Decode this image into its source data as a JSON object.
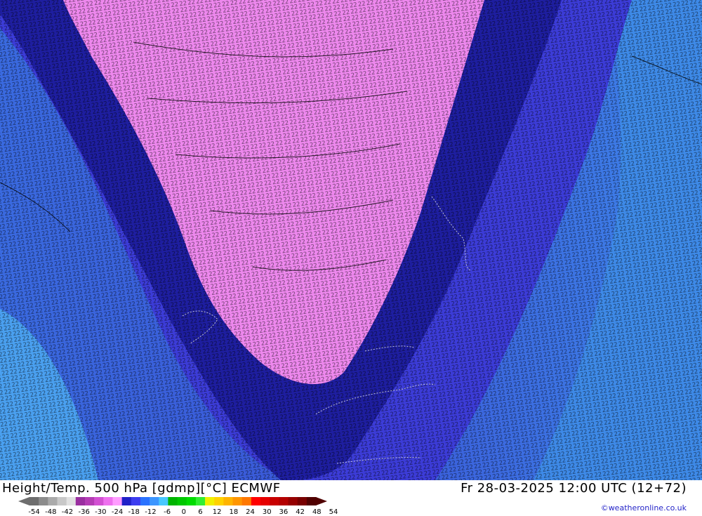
{
  "title_left": "Height/Temp. 500 hPa [gdmp][°C] ECMWF",
  "title_right": "Fr 28-03-2025 12:00 UTC (12+72)",
  "credit": "©weatheronline.co.uk",
  "legend": {
    "ticks": [
      "-54",
      "-48",
      "-42",
      "-36",
      "-30",
      "-24",
      "-18",
      "-12",
      "-6",
      "0",
      "6",
      "12",
      "18",
      "24",
      "30",
      "36",
      "42",
      "48",
      "54"
    ],
    "colors": [
      "#6e6e6e",
      "#8c8c8c",
      "#aaaaaa",
      "#c8c8c8",
      "#e1e1e1",
      "#9a2fa0",
      "#b43cb4",
      "#d250d2",
      "#ee70ee",
      "#ff9cff",
      "#2020c8",
      "#3c3cf0",
      "#2a72ff",
      "#3c96ff",
      "#48c8ff",
      "#00b400",
      "#00c800",
      "#00dc00",
      "#32ee32",
      "#f0f000",
      "#ffd200",
      "#ffb400",
      "#ff9600",
      "#ff7800",
      "#ff0000",
      "#e60000",
      "#c80000",
      "#b40000",
      "#960000",
      "#780000",
      "#500000"
    ]
  },
  "map": {
    "colors": {
      "cold_core": "#ee88ee",
      "band": "#1e1ea0",
      "mid": "#3c3cd8",
      "outer": "#3a6ae0",
      "warm_edge": "#4aa0f0",
      "contour": "#000000"
    }
  }
}
